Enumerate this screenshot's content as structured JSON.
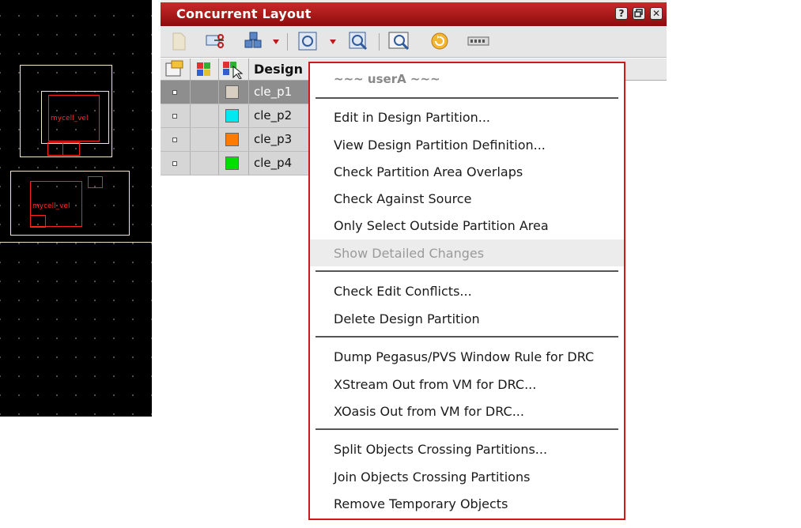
{
  "canvas": {
    "cells": [
      {
        "label": "mycell_vel"
      },
      {
        "label": "mycell_vel"
      }
    ]
  },
  "panel": {
    "title": "Concurrent Layout",
    "window_controls": [
      "?",
      "restore",
      "close"
    ],
    "toolbar": [
      "new-icon",
      "cut-icon",
      "cubes-icon",
      "zoom-fit-icon",
      "zoom-select-icon",
      "inspect-icon",
      "refresh-icon",
      "grid-icon"
    ],
    "table": {
      "column_header_design": "Design",
      "rows": [
        {
          "name": "cle_p1",
          "color": "#d8cfc2",
          "selected": true
        },
        {
          "name": "cle_p2",
          "color": "#00e8f0",
          "selected": false
        },
        {
          "name": "cle_p3",
          "color": "#ff7a00",
          "selected": false
        },
        {
          "name": "cle_p4",
          "color": "#00e000",
          "selected": false
        }
      ]
    }
  },
  "menu": {
    "header": "~~~ userA ~~~",
    "items": [
      "Edit in Design Partition...",
      "View Design Partition Definition...",
      "Check Partition Area Overlaps",
      "Check Against Source",
      "Only Select Outside Partition Area",
      "Show Detailed Changes",
      "Check Edit Conflicts...",
      "Delete Design Partition",
      "Dump Pegasus/PVS Window Rule for DRC",
      "XStream Out from VM for DRC...",
      "XOasis Out from VM for DRC...",
      "Split Objects Crossing Partitions...",
      "Join Objects Crossing Partitions",
      "Remove Temporary Objects"
    ]
  }
}
